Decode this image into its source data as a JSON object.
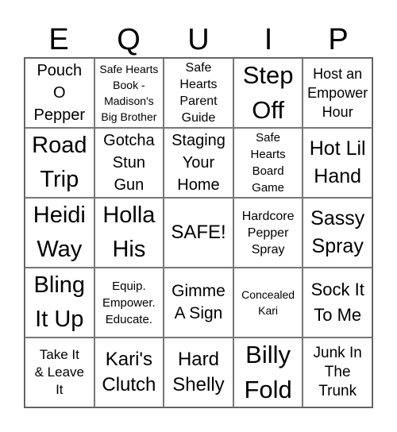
{
  "title_letters": [
    "E",
    "Q",
    "U",
    "I",
    "P"
  ],
  "board": {
    "rows": [
      [
        "Pouch\nO\nPepper",
        "Safe Hearts\nBook -\nMadison's\nBig Brother",
        "Safe\nHearts\nParent\nGuide",
        "Step\nOff",
        "Host an\nEmpower\nHour"
      ],
      [
        "Road\nTrip",
        "Gotcha\nStun\nGun",
        "Staging\nYour\nHome",
        "Safe\nHearts\nBoard\nGame",
        "Hot Lil\nHand"
      ],
      [
        "Heidi\nWay",
        "Holla\nHis",
        "SAFE!",
        "Hardcore\nPepper\nSpray",
        "Sassy\nSpray"
      ],
      [
        "Bling\nIt Up",
        "Equip.\nEmpower.\nEducate.",
        "Gimme\nA Sign",
        "Concealed\nKari",
        "Sock It\nTo Me"
      ],
      [
        "Take It\n& Leave\nIt",
        "Kari's\nClutch",
        "Hard\nShelly",
        "Billy\nFold",
        "Junk In\nThe\nTrunk"
      ]
    ],
    "free_space": "SAFE!"
  }
}
